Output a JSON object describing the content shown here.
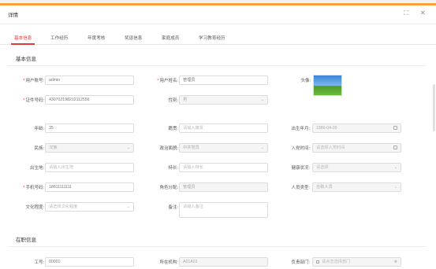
{
  "dialog": {
    "title": "详情",
    "maximize_glyph": "⛶",
    "close_glyph": "✕"
  },
  "tabs": [
    {
      "label": "基本信息",
      "active": true
    },
    {
      "label": "工作经历",
      "active": false
    },
    {
      "label": "年度考核",
      "active": false
    },
    {
      "label": "奖惩信息",
      "active": false
    },
    {
      "label": "家庭成员",
      "active": false
    },
    {
      "label": "学习教育经历",
      "active": false
    }
  ],
  "sections": {
    "basic": "基本信息",
    "job": "在职信息"
  },
  "fields": {
    "account": {
      "label": "用户账号:",
      "value": "admin",
      "required": true
    },
    "username": {
      "label": "用户姓名:",
      "value": "管理员",
      "required": true
    },
    "avatar": {
      "label": "头像:"
    },
    "idcard": {
      "label": "证件号码:",
      "value": "430702198212112556",
      "required": true
    },
    "gender": {
      "label": "性别:",
      "value": "男"
    },
    "age": {
      "label": "年龄:",
      "value": "35"
    },
    "origin": {
      "label": "籍贯:",
      "placeholder": "请输入籍贯"
    },
    "birth": {
      "label": "出生年月:",
      "value": "1986-04-09"
    },
    "ethnic": {
      "label": "民族:",
      "value": "汉族"
    },
    "party": {
      "label": "政治面貌:",
      "value": "中共党员"
    },
    "joinparty": {
      "label": "入党时间:",
      "placeholder": "请选择入党时间"
    },
    "birthplace": {
      "label": "出生地:",
      "placeholder": "请输入出生地"
    },
    "specialty": {
      "label": "特长:",
      "placeholder": "请输入特长"
    },
    "health": {
      "label": "健康状况:",
      "placeholder": "请选择"
    },
    "phone": {
      "label": "手机号码:",
      "value": "18611111111",
      "required": true
    },
    "role": {
      "label": "角色分配:",
      "value": "管理员"
    },
    "persontype": {
      "label": "人员类型:",
      "value": "在职人员"
    },
    "education": {
      "label": "文化程度:",
      "placeholder": "请选择文化程度"
    },
    "remark": {
      "label": "备注:",
      "placeholder": "请输入备注"
    },
    "jobno": {
      "label": "工号:",
      "value": "00001"
    },
    "org": {
      "label": "所在机构:",
      "value": "A01A01"
    },
    "dept": {
      "label": "负责部门:",
      "placeholder": "请点击选择部门"
    }
  }
}
